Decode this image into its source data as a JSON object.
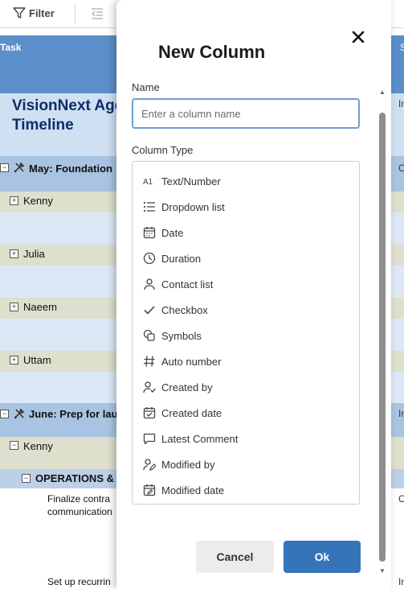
{
  "toolbar": {
    "filter_label": "Filter"
  },
  "grid": {
    "task_header": "Task",
    "sheet_title": "VisionNext Age",
    "sheet_title_2": "Timeline",
    "right_stub_s": "S",
    "rows": {
      "may": "May: Foundation",
      "kenny": "Kenny",
      "julia": "Julia",
      "naeem": "Naeem",
      "uttam": "Uttam",
      "june": "June: Prep for lau",
      "kenny2": "Kenny",
      "ops": "OPERATIONS &",
      "finalize": "Finalize contra",
      "communication": "communication",
      "setup": "Set up recurrin"
    },
    "right_stubs": {
      "r1": "In",
      "r2": "O",
      "r3": "In",
      "r4": "O",
      "r5": "In"
    }
  },
  "modal": {
    "title": "New Column",
    "name_label": "Name",
    "name_placeholder": "Enter a column name",
    "type_label": "Column Type",
    "types": [
      {
        "label": "Text/Number",
        "icon": "text-number-icon"
      },
      {
        "label": "Dropdown list",
        "icon": "list-icon"
      },
      {
        "label": "Date",
        "icon": "calendar-icon"
      },
      {
        "label": "Duration",
        "icon": "clock-icon"
      },
      {
        "label": "Contact list",
        "icon": "person-icon"
      },
      {
        "label": "Checkbox",
        "icon": "checkmark-icon"
      },
      {
        "label": "Symbols",
        "icon": "symbols-icon"
      },
      {
        "label": "Auto number",
        "icon": "hash-icon"
      },
      {
        "label": "Created by",
        "icon": "person-check-icon"
      },
      {
        "label": "Created date",
        "icon": "calendar-check-icon"
      },
      {
        "label": "Latest Comment",
        "icon": "comment-icon"
      },
      {
        "label": "Modified by",
        "icon": "person-edit-icon"
      },
      {
        "label": "Modified date",
        "icon": "calendar-edit-icon"
      }
    ],
    "cancel_label": "Cancel",
    "ok_label": "Ok"
  }
}
